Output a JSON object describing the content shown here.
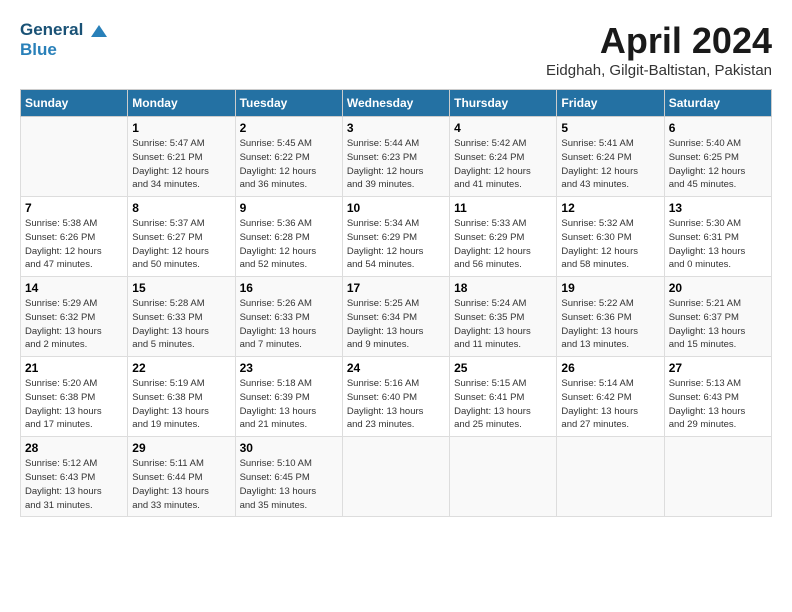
{
  "logo": {
    "line1": "General",
    "line2": "Blue"
  },
  "title": "April 2024",
  "location": "Eidghah, Gilgit-Baltistan, Pakistan",
  "days_header": [
    "Sunday",
    "Monday",
    "Tuesday",
    "Wednesday",
    "Thursday",
    "Friday",
    "Saturday"
  ],
  "weeks": [
    [
      {
        "day": "",
        "sunrise": "",
        "sunset": "",
        "daylight": ""
      },
      {
        "day": "1",
        "sunrise": "Sunrise: 5:47 AM",
        "sunset": "Sunset: 6:21 PM",
        "daylight": "Daylight: 12 hours and 34 minutes."
      },
      {
        "day": "2",
        "sunrise": "Sunrise: 5:45 AM",
        "sunset": "Sunset: 6:22 PM",
        "daylight": "Daylight: 12 hours and 36 minutes."
      },
      {
        "day": "3",
        "sunrise": "Sunrise: 5:44 AM",
        "sunset": "Sunset: 6:23 PM",
        "daylight": "Daylight: 12 hours and 39 minutes."
      },
      {
        "day": "4",
        "sunrise": "Sunrise: 5:42 AM",
        "sunset": "Sunset: 6:24 PM",
        "daylight": "Daylight: 12 hours and 41 minutes."
      },
      {
        "day": "5",
        "sunrise": "Sunrise: 5:41 AM",
        "sunset": "Sunset: 6:24 PM",
        "daylight": "Daylight: 12 hours and 43 minutes."
      },
      {
        "day": "6",
        "sunrise": "Sunrise: 5:40 AM",
        "sunset": "Sunset: 6:25 PM",
        "daylight": "Daylight: 12 hours and 45 minutes."
      }
    ],
    [
      {
        "day": "7",
        "sunrise": "Sunrise: 5:38 AM",
        "sunset": "Sunset: 6:26 PM",
        "daylight": "Daylight: 12 hours and 47 minutes."
      },
      {
        "day": "8",
        "sunrise": "Sunrise: 5:37 AM",
        "sunset": "Sunset: 6:27 PM",
        "daylight": "Daylight: 12 hours and 50 minutes."
      },
      {
        "day": "9",
        "sunrise": "Sunrise: 5:36 AM",
        "sunset": "Sunset: 6:28 PM",
        "daylight": "Daylight: 12 hours and 52 minutes."
      },
      {
        "day": "10",
        "sunrise": "Sunrise: 5:34 AM",
        "sunset": "Sunset: 6:29 PM",
        "daylight": "Daylight: 12 hours and 54 minutes."
      },
      {
        "day": "11",
        "sunrise": "Sunrise: 5:33 AM",
        "sunset": "Sunset: 6:29 PM",
        "daylight": "Daylight: 12 hours and 56 minutes."
      },
      {
        "day": "12",
        "sunrise": "Sunrise: 5:32 AM",
        "sunset": "Sunset: 6:30 PM",
        "daylight": "Daylight: 12 hours and 58 minutes."
      },
      {
        "day": "13",
        "sunrise": "Sunrise: 5:30 AM",
        "sunset": "Sunset: 6:31 PM",
        "daylight": "Daylight: 13 hours and 0 minutes."
      }
    ],
    [
      {
        "day": "14",
        "sunrise": "Sunrise: 5:29 AM",
        "sunset": "Sunset: 6:32 PM",
        "daylight": "Daylight: 13 hours and 2 minutes."
      },
      {
        "day": "15",
        "sunrise": "Sunrise: 5:28 AM",
        "sunset": "Sunset: 6:33 PM",
        "daylight": "Daylight: 13 hours and 5 minutes."
      },
      {
        "day": "16",
        "sunrise": "Sunrise: 5:26 AM",
        "sunset": "Sunset: 6:33 PM",
        "daylight": "Daylight: 13 hours and 7 minutes."
      },
      {
        "day": "17",
        "sunrise": "Sunrise: 5:25 AM",
        "sunset": "Sunset: 6:34 PM",
        "daylight": "Daylight: 13 hours and 9 minutes."
      },
      {
        "day": "18",
        "sunrise": "Sunrise: 5:24 AM",
        "sunset": "Sunset: 6:35 PM",
        "daylight": "Daylight: 13 hours and 11 minutes."
      },
      {
        "day": "19",
        "sunrise": "Sunrise: 5:22 AM",
        "sunset": "Sunset: 6:36 PM",
        "daylight": "Daylight: 13 hours and 13 minutes."
      },
      {
        "day": "20",
        "sunrise": "Sunrise: 5:21 AM",
        "sunset": "Sunset: 6:37 PM",
        "daylight": "Daylight: 13 hours and 15 minutes."
      }
    ],
    [
      {
        "day": "21",
        "sunrise": "Sunrise: 5:20 AM",
        "sunset": "Sunset: 6:38 PM",
        "daylight": "Daylight: 13 hours and 17 minutes."
      },
      {
        "day": "22",
        "sunrise": "Sunrise: 5:19 AM",
        "sunset": "Sunset: 6:38 PM",
        "daylight": "Daylight: 13 hours and 19 minutes."
      },
      {
        "day": "23",
        "sunrise": "Sunrise: 5:18 AM",
        "sunset": "Sunset: 6:39 PM",
        "daylight": "Daylight: 13 hours and 21 minutes."
      },
      {
        "day": "24",
        "sunrise": "Sunrise: 5:16 AM",
        "sunset": "Sunset: 6:40 PM",
        "daylight": "Daylight: 13 hours and 23 minutes."
      },
      {
        "day": "25",
        "sunrise": "Sunrise: 5:15 AM",
        "sunset": "Sunset: 6:41 PM",
        "daylight": "Daylight: 13 hours and 25 minutes."
      },
      {
        "day": "26",
        "sunrise": "Sunrise: 5:14 AM",
        "sunset": "Sunset: 6:42 PM",
        "daylight": "Daylight: 13 hours and 27 minutes."
      },
      {
        "day": "27",
        "sunrise": "Sunrise: 5:13 AM",
        "sunset": "Sunset: 6:43 PM",
        "daylight": "Daylight: 13 hours and 29 minutes."
      }
    ],
    [
      {
        "day": "28",
        "sunrise": "Sunrise: 5:12 AM",
        "sunset": "Sunset: 6:43 PM",
        "daylight": "Daylight: 13 hours and 31 minutes."
      },
      {
        "day": "29",
        "sunrise": "Sunrise: 5:11 AM",
        "sunset": "Sunset: 6:44 PM",
        "daylight": "Daylight: 13 hours and 33 minutes."
      },
      {
        "day": "30",
        "sunrise": "Sunrise: 5:10 AM",
        "sunset": "Sunset: 6:45 PM",
        "daylight": "Daylight: 13 hours and 35 minutes."
      },
      {
        "day": "",
        "sunrise": "",
        "sunset": "",
        "daylight": ""
      },
      {
        "day": "",
        "sunrise": "",
        "sunset": "",
        "daylight": ""
      },
      {
        "day": "",
        "sunrise": "",
        "sunset": "",
        "daylight": ""
      },
      {
        "day": "",
        "sunrise": "",
        "sunset": "",
        "daylight": ""
      }
    ]
  ]
}
